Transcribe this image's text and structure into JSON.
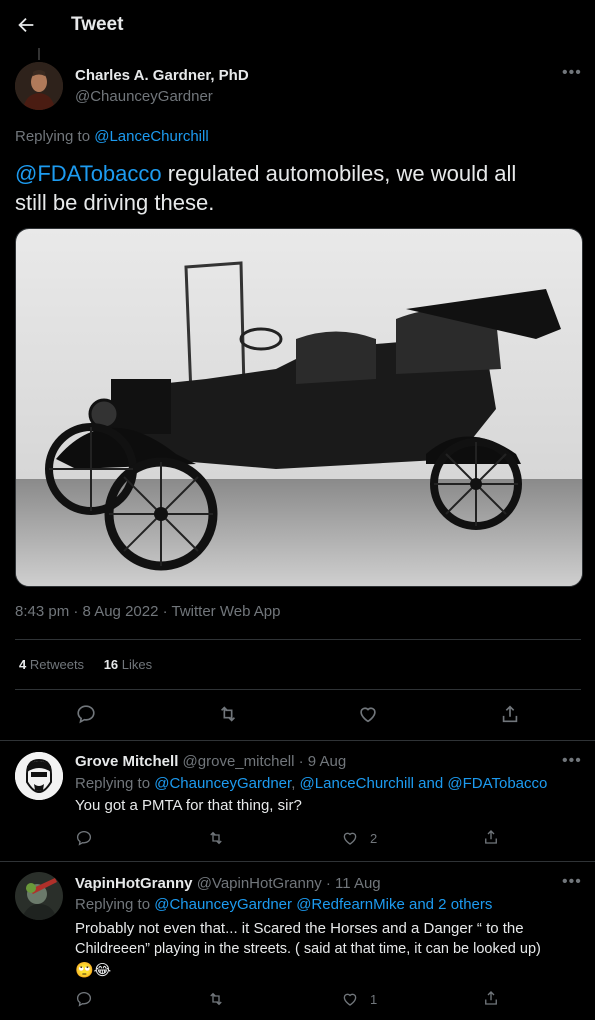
{
  "header": {
    "title": "Tweet"
  },
  "tweet": {
    "author_name": "Charles A. Gardner, PhD",
    "author_handle": "@ChaunceyGardner",
    "replying_label": "Replying to",
    "replying_to": "@LanceChurchill",
    "text_mention": "@FDATobacco",
    "text_line1_rest": " regulated automobiles, we would all",
    "text_line2": "still be driving these.",
    "timestamp": "8:43 pm · 8 Aug 2022 · Twitter Web App",
    "retweets_count": "4",
    "retweets_label": "Retweets",
    "likes_count": "16",
    "likes_label": "Likes",
    "image_alt": "Vintage Ford Model T touring car"
  },
  "replies": [
    {
      "name": "Grove Mitchell",
      "handle_time": "@grove_mitchell · 9 Aug",
      "replying_label": "Replying to",
      "replying_to_1": "@ChaunceyGardner",
      "replying_sep": ", ",
      "replying_to_2": "@LanceChurchill",
      "replying_and": " and ",
      "replying_to_3": "@FDATobacco",
      "text": "You got a PMTA for that thing, sir?",
      "like_count": "2"
    },
    {
      "name": "VapinHotGranny",
      "handle_time": "@VapinHotGranny · 11 Aug",
      "replying_label": "Replying to",
      "replying_to_1": "@ChaunceyGardner",
      "replying_to_2": "@RedfearnMike",
      "replying_and": " and 2 others",
      "text_line1": "Probably not even that... it Scared the Horses and a Danger “ to the",
      "text_line2": "Childreeen” playing in the streets. ( said at that time, it can be looked up)",
      "emoji": "🙄😂",
      "like_count": "1"
    }
  ],
  "colors": {
    "background": "#000000",
    "accent": "#1d9bf0",
    "muted": "#71767b",
    "divider": "#2f3336"
  }
}
